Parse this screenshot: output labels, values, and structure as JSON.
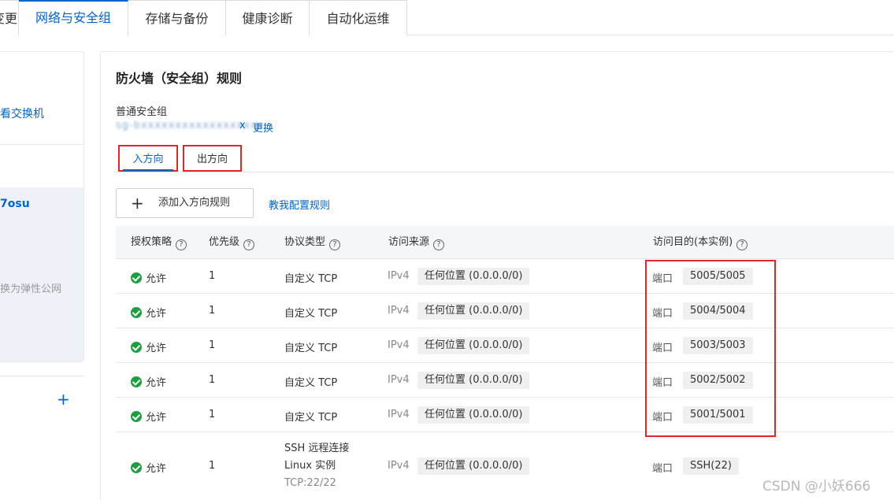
{
  "top_tabs": [
    {
      "label": "变更",
      "partial": true
    },
    {
      "label": "网络与安全组",
      "active": true
    },
    {
      "label": "存储与备份"
    },
    {
      "label": "健康诊断"
    },
    {
      "label": "自动化运维"
    }
  ],
  "left_panel": {
    "link_text": "看交换机",
    "instance_id_fragment": "7osu",
    "hint_text": "换为弹性公网"
  },
  "card": {
    "title": "防火墙（安全组）规则",
    "sg_label": "普通安全组",
    "sg_id_masked": "sg-bxxxxxxxxxxxxxxxxxx",
    "sg_id_suffix": "x",
    "change_link": "更换"
  },
  "direction_tabs": {
    "inbound": "入方向",
    "outbound": "出方向"
  },
  "actions": {
    "add_rule": "添加入方向规则",
    "teach_link": "教我配置规则"
  },
  "table": {
    "columns": [
      "授权策略",
      "优先级",
      "协议类型",
      "访问来源",
      "访问目的(本实例)"
    ],
    "rows": [
      {
        "policy": "允许",
        "priority": "1",
        "protocol": "自定义 TCP",
        "ip_version": "IPv4",
        "source": "任何位置 (0.0.0.0/0)",
        "dest_label": "端口",
        "dest_port": "5005/5005"
      },
      {
        "policy": "允许",
        "priority": "1",
        "protocol": "自定义 TCP",
        "ip_version": "IPv4",
        "source": "任何位置 (0.0.0.0/0)",
        "dest_label": "端口",
        "dest_port": "5004/5004"
      },
      {
        "policy": "允许",
        "priority": "1",
        "protocol": "自定义 TCP",
        "ip_version": "IPv4",
        "source": "任何位置 (0.0.0.0/0)",
        "dest_label": "端口",
        "dest_port": "5003/5003"
      },
      {
        "policy": "允许",
        "priority": "1",
        "protocol": "自定义 TCP",
        "ip_version": "IPv4",
        "source": "任何位置 (0.0.0.0/0)",
        "dest_label": "端口",
        "dest_port": "5002/5002"
      },
      {
        "policy": "允许",
        "priority": "1",
        "protocol": "自定义 TCP",
        "ip_version": "IPv4",
        "source": "任何位置 (0.0.0.0/0)",
        "dest_label": "端口",
        "dest_port": "5001/5001"
      }
    ],
    "ssh_row": {
      "policy": "允许",
      "priority": "1",
      "protocol_line1": "SSH 远程连接",
      "protocol_line2": "Linux 实例",
      "protocol_line3": "TCP:22/22",
      "ip_version": "IPv4",
      "source": "任何位置 (0.0.0.0/0)",
      "dest_label": "端口",
      "dest_port": "SSH(22)"
    }
  },
  "watermark": "CSDN @小妖666",
  "colors": {
    "accent": "#0064c8",
    "allow_green": "#1e9e40",
    "highlight_red": "#e4262b"
  }
}
